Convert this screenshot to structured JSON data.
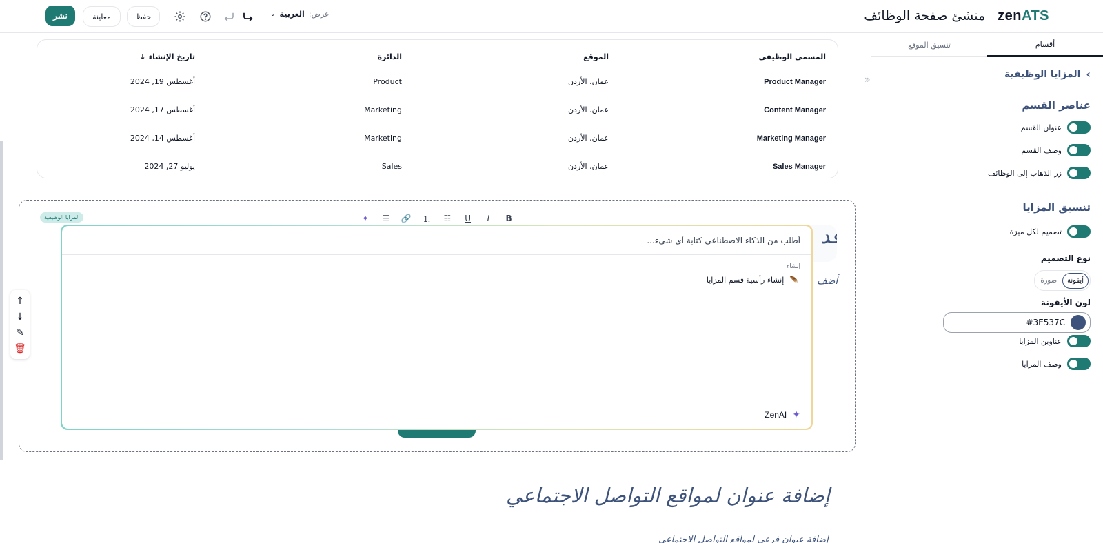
{
  "header": {
    "logo_zen": "zen",
    "logo_ats": "ATS",
    "title": "منشئ صفحة الوظائف",
    "publish_label": "نشر",
    "preview_label": "معاينة",
    "save_label": "حفظ",
    "view_label": "عرض:",
    "language_value": "العربية"
  },
  "sidebar": {
    "tabs": [
      {
        "label": "أقسام",
        "active": true
      },
      {
        "label": "تنسيق الموقع",
        "active": false
      }
    ],
    "back_title": "المزايا الوظيفية",
    "section_elements_title": "عناصر القسم",
    "section_toggles": [
      {
        "label": "عنوان القسم",
        "on": true
      },
      {
        "label": "وصف القسم",
        "on": true
      },
      {
        "label": "زر الذهاب إلى الوظائف",
        "on": true
      }
    ],
    "benefits_format_title": "تنسيق المزايا",
    "design_toggle": {
      "label": "تصميم لكل ميزة",
      "on": true
    },
    "design_type_label": "نوع التصميم",
    "design_type_options": [
      "أيقونة",
      "صورة"
    ],
    "design_type_selected": "أيقونة",
    "icon_color_label": "لون الأيقونة",
    "icon_color_value": "#3E537C",
    "icon_color_swatch": "#3E537C",
    "bottom_toggles": [
      {
        "label": "عناوين المزايا",
        "on": true
      },
      {
        "label": "وصف المزايا",
        "on": true
      }
    ]
  },
  "jobs_table": {
    "columns": [
      "المسمى الوظيفي",
      "الموقع",
      "الدائرة",
      "تاريخ الإنشاء ↓"
    ],
    "rows": [
      {
        "title": "Product Manager",
        "location": "عمان، الأردن",
        "department": "Product",
        "created": "أغسطس 19, 2024"
      },
      {
        "title": "Content Manager",
        "location": "عمان، الأردن",
        "department": "Marketing",
        "created": "أغسطس 17, 2024"
      },
      {
        "title": "Marketing Manager",
        "location": "عمان، الأردن",
        "department": "Marketing",
        "created": "أغسطس 14, 2024"
      },
      {
        "title": "Sales Manager",
        "location": "عمان، الأردن",
        "department": "Sales",
        "created": "يوليو 27, 2024"
      }
    ]
  },
  "benefits_section": {
    "badge": "المزايا الوظيفية",
    "heading_peek": "قد",
    "desc_peek": "أضف"
  },
  "format_toolbar": [
    "B",
    "I",
    "U",
    "•≡",
    "1≡",
    "🔗",
    "≡",
    "✦"
  ],
  "ai_popup": {
    "placeholder": "أطلب من الذكاء الاصطناعي كتابة أي شيء...",
    "group_label": "إنشاء",
    "suggestion": "إنشاء رأسية قسم المزايا",
    "brand": "ZenAI"
  },
  "social_section": {
    "title": "إضافة عنوان لمواقع التواصل الاجتماعي",
    "subtitle": "إضافة عنوان فرعي لمواقع التواصل الاجتماعي"
  },
  "colors": {
    "brand_teal": "#1f7a73",
    "navy": "#3E537C"
  }
}
